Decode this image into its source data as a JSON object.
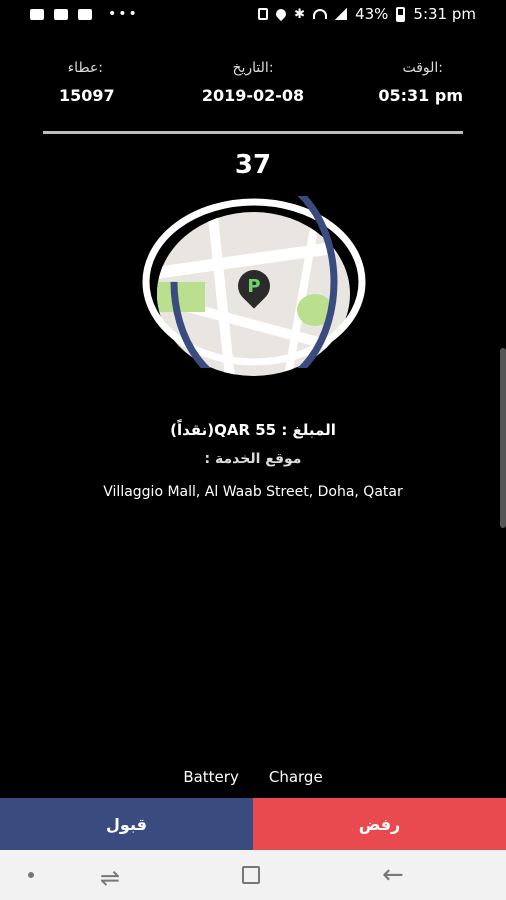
{
  "status_bar": {
    "battery": "43%",
    "time": "5:31 pm",
    "icons_left": [
      "notification-icon",
      "youtube-icon",
      "camera-icon",
      "more-icon"
    ],
    "icons_right": [
      "alarm-icon",
      "location-icon",
      "bluetooth-icon",
      "wifi-icon",
      "signal-icon",
      "battery-icon"
    ]
  },
  "header": {
    "time_label": "الوقت:",
    "time_value": "05:31 pm",
    "date_label": "التاريخ:",
    "date_value": "2019-02-08",
    "bid_label": "عطاء:",
    "bid_value": "15097"
  },
  "countdown": "37",
  "details": {
    "amount_text": "المبلغ : QAR 55(نقداً)",
    "location_label": "موقع الخدمة :",
    "address": "Villaggio Mall, Al Waab Street, Doha, Qatar"
  },
  "bottom_labels": {
    "battery": "Battery",
    "charge": "Charge"
  },
  "actions": {
    "accept": "قبول",
    "reject": "رفض"
  },
  "colors": {
    "accept": "#3a4b80",
    "reject": "#e84a4f",
    "ring": "#3a4b80"
  },
  "map": {
    "pin_letter": "P"
  },
  "timer": {
    "remaining_fraction": 0.75
  }
}
